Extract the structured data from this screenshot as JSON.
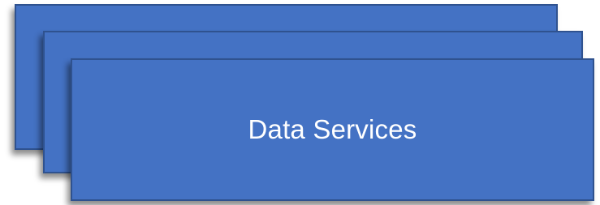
{
  "diagram": {
    "fill_color": "#4472c4",
    "border_color": "#2f528f",
    "text_color": "#ffffff",
    "stack_count": 3,
    "label": "Data Services"
  }
}
